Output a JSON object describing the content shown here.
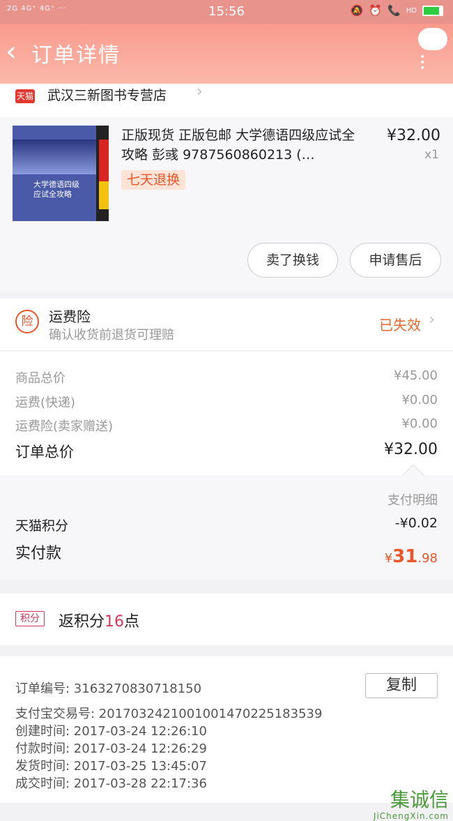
{
  "status_bar": {
    "left": "2G 4G⁺ 4G⁺ ···",
    "time": "15:56",
    "icons_text": "HD",
    "icons": [
      "mute-icon",
      "alarm-icon",
      "call-icon",
      "battery-icon"
    ]
  },
  "nav": {
    "back_icon": "chevron-left",
    "title": "订单详情",
    "more_icon": "more-dots"
  },
  "store": {
    "badge": "天猫",
    "name": "武汉三新图书专营店"
  },
  "product": {
    "cover_text": "大学德语四级\n应试全攻略",
    "title": "正版现货 正版包邮 大学德语四级应试全攻略 彭彧 9787560860213 (…",
    "price": "¥32.00",
    "quantity": "x1",
    "tag": "七天退换",
    "btn_resell": "卖了换钱",
    "btn_aftersale": "申请售后"
  },
  "insurance": {
    "icon_label": "险",
    "title": "运费险",
    "subtitle": "确认收货前退货可理赔",
    "status": "已失效",
    "status_color": "#e8662a"
  },
  "price": {
    "rows": [
      {
        "label": "商品总价",
        "value": "¥45.00"
      },
      {
        "label": "运费(快递)",
        "value": "¥0.00"
      },
      {
        "label": "运费险(卖家赠送)",
        "value": "¥0.00"
      }
    ],
    "total_label": "订单总价",
    "total_value": "¥32.00"
  },
  "payment": {
    "detail_link": "支付明细",
    "points_label": "天猫积分",
    "points_value": "-¥0.02",
    "paid_label": "实付款",
    "paid_currency": "¥",
    "paid_integer": "31",
    "paid_decimal": ".98"
  },
  "rebate": {
    "tag": "积分",
    "text_prefix": "返积分",
    "points": "16",
    "text_suffix": "点"
  },
  "order_info": {
    "lines": [
      "订单编号: 3163270830718150",
      "支付宝交易号: 2017032421001001470225183539",
      "创建时间: 2017-03-24 12:26:10",
      "付款时间: 2017-03-24 12:26:29",
      "发货时间: 2017-03-25 13:45:07",
      "成交时间: 2017-03-28 22:17:36"
    ],
    "copy_button": "复制"
  },
  "watermark": {
    "text": "集诚信",
    "sub": "JiChengXin.com"
  }
}
